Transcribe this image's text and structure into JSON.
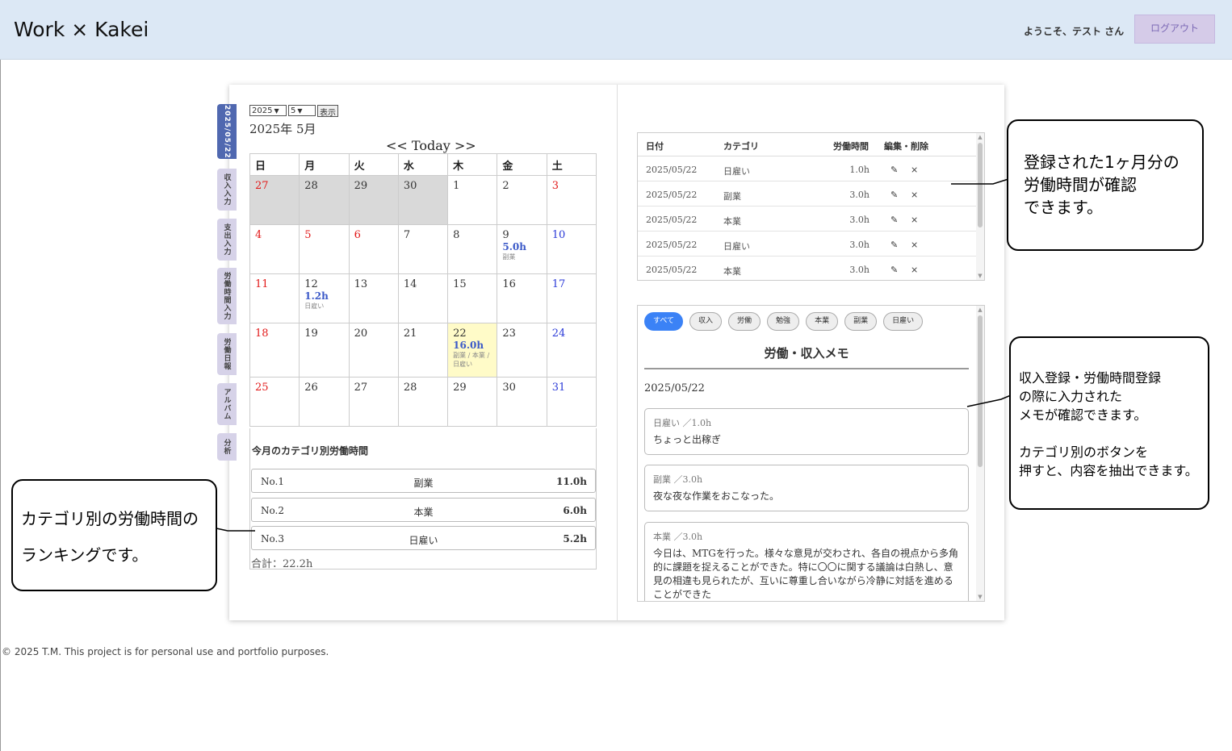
{
  "header": {
    "app_title": "Work × Kakei",
    "welcome": "ようこそ、テスト さん",
    "logout_label": "ログアウト"
  },
  "tabs": [
    {
      "label": "2025/05/22",
      "active": true
    },
    {
      "label": "収入入力"
    },
    {
      "label": "支出入力"
    },
    {
      "label": "労働時間入力"
    },
    {
      "label": "労働日報"
    },
    {
      "label": "アルバム"
    },
    {
      "label": "分析"
    }
  ],
  "calendar": {
    "year_select": "2025",
    "month_select": "5",
    "show_button": "表示",
    "month_label": "2025年 5月",
    "nav_today": "<< Today >>",
    "weekdays": [
      "日",
      "月",
      "火",
      "水",
      "木",
      "金",
      "土"
    ],
    "weeks": [
      [
        {
          "d": "27"
        },
        {
          "d": "28"
        },
        {
          "d": "29"
        },
        {
          "d": "30"
        },
        {
          "d": "1"
        },
        {
          "d": "2"
        },
        {
          "d": "3"
        }
      ],
      [
        {
          "d": "4"
        },
        {
          "d": "5"
        },
        {
          "d": "6"
        },
        {
          "d": "7"
        },
        {
          "d": "8"
        },
        {
          "d": "9",
          "h": "5.0h",
          "c": "副業"
        },
        {
          "d": "10"
        }
      ],
      [
        {
          "d": "11"
        },
        {
          "d": "12",
          "h": "1.2h",
          "c": "日雇い"
        },
        {
          "d": "13"
        },
        {
          "d": "14"
        },
        {
          "d": "15"
        },
        {
          "d": "16"
        },
        {
          "d": "17"
        }
      ],
      [
        {
          "d": "18"
        },
        {
          "d": "19"
        },
        {
          "d": "20"
        },
        {
          "d": "21"
        },
        {
          "d": "22",
          "h": "16.0h",
          "c": "副業 / 本業 / 日雇い"
        },
        {
          "d": "23"
        },
        {
          "d": "24"
        }
      ],
      [
        {
          "d": "25"
        },
        {
          "d": "26"
        },
        {
          "d": "27"
        },
        {
          "d": "28"
        },
        {
          "d": "29"
        },
        {
          "d": "30"
        },
        {
          "d": "31"
        }
      ]
    ]
  },
  "ranking": {
    "title": "今月のカテゴリ別労働時間",
    "rows": [
      {
        "no": "No.1",
        "category": "副業",
        "hours": "11.0h"
      },
      {
        "no": "No.2",
        "category": "本業",
        "hours": "6.0h"
      },
      {
        "no": "No.3",
        "category": "日雇い",
        "hours": "5.2h"
      }
    ],
    "total": "合計：22.2h"
  },
  "work_log": {
    "headers": {
      "date": "日付",
      "category": "カテゴリ",
      "hours": "労働時間",
      "actions": "編集・削除"
    },
    "rows": [
      {
        "date": "2025/05/22",
        "category": "日雇い",
        "hours": "1.0h"
      },
      {
        "date": "2025/05/22",
        "category": "副業",
        "hours": "3.0h"
      },
      {
        "date": "2025/05/22",
        "category": "本業",
        "hours": "3.0h"
      },
      {
        "date": "2025/05/22",
        "category": "日雇い",
        "hours": "3.0h"
      },
      {
        "date": "2025/05/22",
        "category": "本業",
        "hours": "3.0h"
      }
    ],
    "edit_icon": "✎",
    "delete_icon": "×"
  },
  "memo": {
    "filters": [
      "すべて",
      "収入",
      "労働",
      "勉強",
      "本業",
      "副業",
      "日雇い"
    ],
    "title": "労働・収入メモ",
    "date": "2025/05/22",
    "cards": [
      {
        "meta": "日雇い ／1.0h",
        "body": "ちょっと出稼ぎ"
      },
      {
        "meta": "副業 ／3.0h",
        "body": "夜な夜な作業をおこなった。"
      },
      {
        "meta": "本業 ／3.0h",
        "body": "今日は、MTGを行った。様々な意見が交わされ、各自の視点から多角的に課題を捉えることができた。特に〇〇に関する議論は白熱し、意見の相違も見られたが、互いに尊重し合いながら冷静に対話を進めることができた"
      }
    ]
  },
  "callouts": {
    "top_right": "登録された1ヶ月分の\n労働時間が確認\nできます。",
    "mid_right": "収入登録・労働時間登録\nの際に入力された\nメモが確認できます。\n\nカテゴリ別のボタンを\n押すと、内容を抽出できます。",
    "left": "カテゴリ別の労働時間の\nランキングです。"
  },
  "footer": "© 2025 T.M. This project is for personal use and portfolio purposes.",
  "colors": {
    "header_bg": "#dce8f5",
    "accent": "#5068b0",
    "sunday": "#e21818",
    "saturday": "#2c3bd8",
    "hours": "#3c5ac8"
  }
}
